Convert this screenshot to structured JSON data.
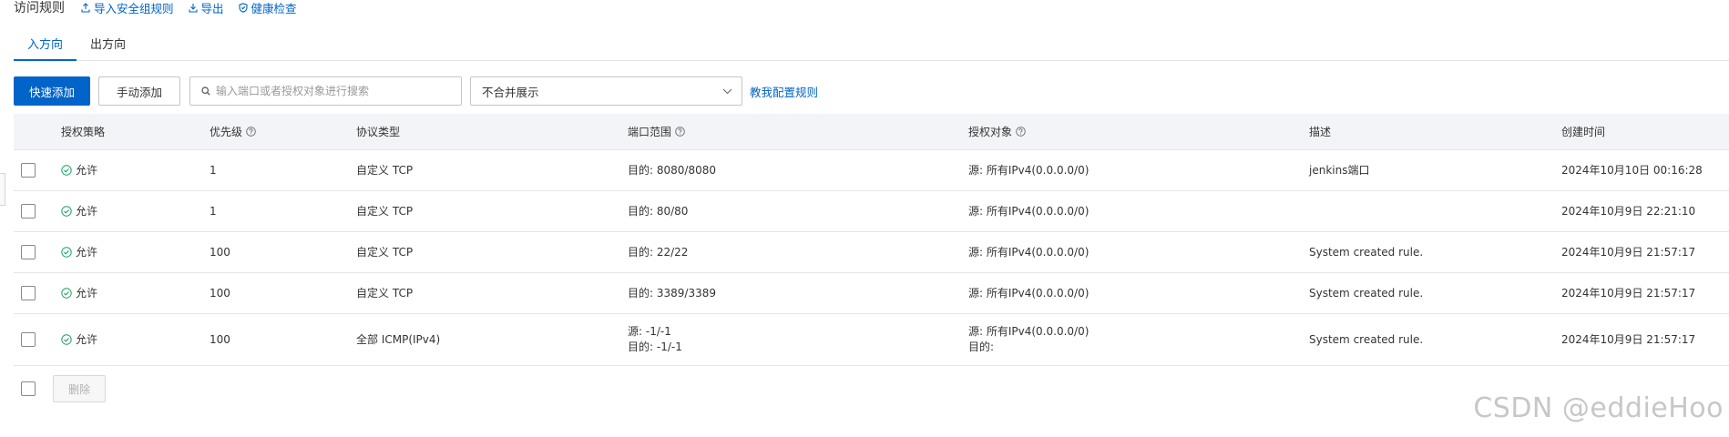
{
  "header": {
    "title": "访问规则",
    "links": [
      {
        "label": "导入安全组规则",
        "icon": "upload-icon"
      },
      {
        "label": "导出",
        "icon": "download-icon"
      },
      {
        "label": "健康检查",
        "icon": "shield-check-icon"
      }
    ]
  },
  "tabs": [
    {
      "label": "入方向",
      "active": true
    },
    {
      "label": "出方向",
      "active": false
    }
  ],
  "toolbar": {
    "quick_add_label": "快速添加",
    "manual_add_label": "手动添加",
    "search_placeholder": "输入端口或者授权对象进行搜索",
    "select_value": "不合并展示",
    "help_link_label": "教我配置规则"
  },
  "table": {
    "columns": [
      "授权策略",
      "优先级",
      "协议类型",
      "端口范围",
      "授权对象",
      "描述",
      "创建时间"
    ],
    "rows": [
      {
        "policy": "允许",
        "priority": "1",
        "protocol": "自定义 TCP",
        "port": [
          "目的: 8080/8080"
        ],
        "auth": [
          "源: 所有IPv4(0.0.0.0/0)"
        ],
        "desc": "jenkins端口",
        "time": "2024年10月10日 00:16:28"
      },
      {
        "policy": "允许",
        "priority": "1",
        "protocol": "自定义 TCP",
        "port": [
          "目的: 80/80"
        ],
        "auth": [
          "源: 所有IPv4(0.0.0.0/0)"
        ],
        "desc": "",
        "time": "2024年10月9日 22:21:10"
      },
      {
        "policy": "允许",
        "priority": "100",
        "protocol": "自定义 TCP",
        "port": [
          "目的: 22/22"
        ],
        "auth": [
          "源: 所有IPv4(0.0.0.0/0)"
        ],
        "desc": "System created rule.",
        "time": "2024年10月9日 21:57:17"
      },
      {
        "policy": "允许",
        "priority": "100",
        "protocol": "自定义 TCP",
        "port": [
          "目的: 3389/3389"
        ],
        "auth": [
          "源: 所有IPv4(0.0.0.0/0)"
        ],
        "desc": "System created rule.",
        "time": "2024年10月9日 21:57:17"
      },
      {
        "policy": "允许",
        "priority": "100",
        "protocol": "全部 ICMP(IPv4)",
        "port": [
          "源: -1/-1",
          "目的: -1/-1"
        ],
        "auth": [
          "源: 所有IPv4(0.0.0.0/0)",
          "目的:"
        ],
        "desc": "System created rule.",
        "time": "2024年10月9日 21:57:17"
      }
    ]
  },
  "footer": {
    "delete_label": "删除"
  },
  "watermark": "CSDN @eddieHoo",
  "colors": {
    "primary": "#0064c8",
    "allow_green": "#1aa35f",
    "header_bg": "#f2f4f7"
  }
}
